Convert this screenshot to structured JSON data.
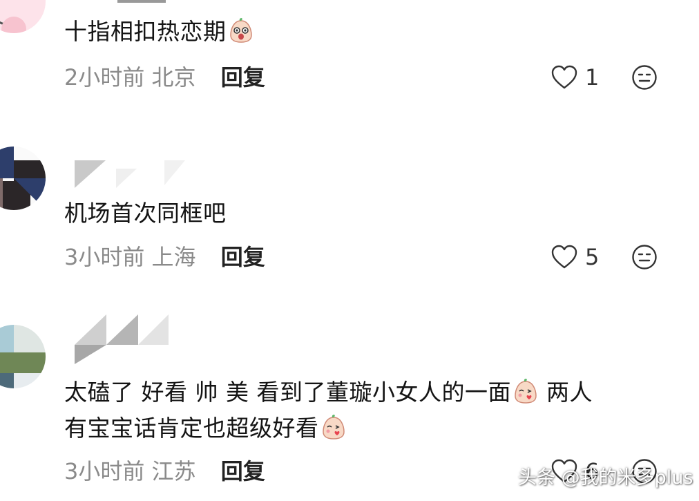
{
  "comments": [
    {
      "text": "十指相扣热恋期",
      "time": "2小时前",
      "location": "北京",
      "reply_label": "回复",
      "like_count": "1"
    },
    {
      "text": "机场首次同框吧",
      "time": "3小时前",
      "location": "上海",
      "reply_label": "回复",
      "like_count": "5"
    },
    {
      "text_line1_a": "太磕了 好看 帅 美 看到了董璇小女人的一面",
      "text_line1_b": " 两人",
      "text_line2": "有宝宝话肯定也超级好看",
      "time": "3小时前",
      "location": "江苏",
      "reply_label": "回复",
      "like_count": "6"
    }
  ],
  "watermark": "头条 @我的米多plus",
  "icons": {
    "like": "heart-outline-icon",
    "dislike": "meh-face-icon",
    "emoji_1": "surprised-peach-emoji",
    "emoji_2": "kiss-peach-emoji"
  },
  "colors": {
    "meta_text": "#8a8a8a",
    "body_text": "#141414",
    "icon_stroke": "#333333",
    "emoji_face": "#f8d9c6"
  }
}
